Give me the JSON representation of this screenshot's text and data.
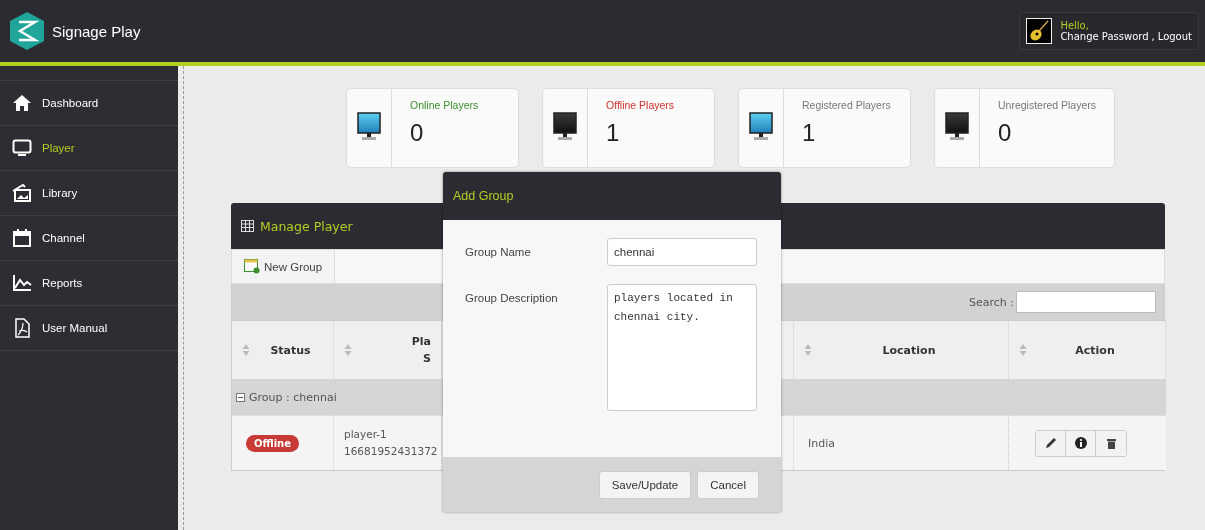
{
  "app": {
    "title": "Signage Play"
  },
  "user": {
    "greeting": "Hello,",
    "links": [
      "Change Password",
      "Logout"
    ],
    "separator": ","
  },
  "sidebar": {
    "items": [
      {
        "label": "Dashboard",
        "selected": false
      },
      {
        "label": "Player",
        "selected": true
      },
      {
        "label": "Library",
        "selected": false
      },
      {
        "label": "Channel",
        "selected": false
      },
      {
        "label": "Reports",
        "selected": false
      },
      {
        "label": "User Manual",
        "selected": false
      }
    ]
  },
  "stats": [
    {
      "label": "Online Players",
      "value": "0",
      "color": "#3a8f2c",
      "kind": "lit"
    },
    {
      "label": "Offline Players",
      "value": "1",
      "color": "#d0312d",
      "kind": "dark"
    },
    {
      "label": "Registered Players",
      "value": "1",
      "color": "#777777",
      "kind": "lit"
    },
    {
      "label": "Unregistered Players",
      "value": "0",
      "color": "#777777",
      "kind": "dark"
    }
  ],
  "panel": {
    "title": "Manage Player",
    "toolbar": {
      "button": "New Group"
    },
    "search": {
      "label": "Search :"
    },
    "columns": [
      {
        "lines": [
          "Status"
        ]
      },
      {
        "lines": [
          "Pla",
          "S"
        ]
      },
      {
        "lines": [
          "Location"
        ]
      },
      {
        "lines": [
          "Action"
        ]
      }
    ],
    "group": {
      "label": "Group : chennai",
      "expanded": true
    },
    "rows": [
      {
        "status": "Offline",
        "color": "#c73a36",
        "player": [
          "player-1",
          "16681952431372"
        ],
        "location": "India"
      }
    ]
  },
  "modal": {
    "title": "Add Group",
    "fields": [
      {
        "label": "Group Name",
        "value": "chennai",
        "kind": "input"
      },
      {
        "label": "Group Description",
        "value": "players located in chennai city.",
        "kind": "textarea"
      }
    ],
    "buttons": [
      "Save/Update",
      "Cancel"
    ]
  }
}
